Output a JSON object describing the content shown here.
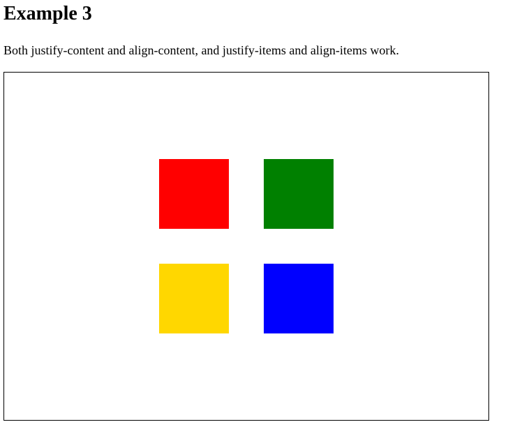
{
  "heading": "Example 3",
  "description": "Both justify-content and align-content, and justify-items and align-items work.",
  "boxes": [
    {
      "color": "#ff0000"
    },
    {
      "color": "#008000"
    },
    {
      "color": "#ffd700"
    },
    {
      "color": "#0000ff"
    }
  ]
}
